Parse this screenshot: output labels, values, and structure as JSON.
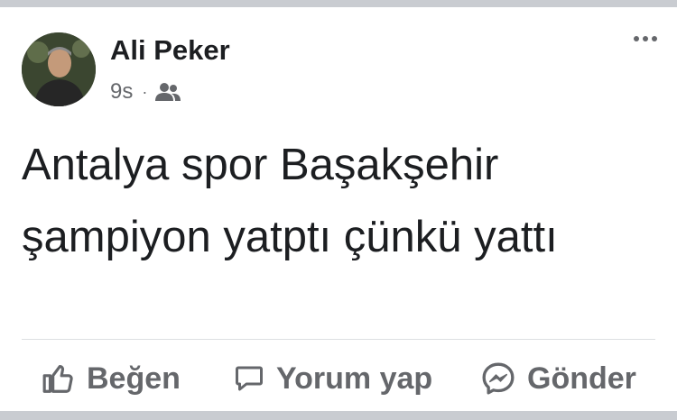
{
  "post": {
    "author": "Ali Peker",
    "time": "9s",
    "separator": "·",
    "audience_icon": "friends-icon",
    "text": "Antalya spor Başakşehir şampiyon yatptı çünkü yattı"
  },
  "actions": {
    "like_label": "Beğen",
    "comment_label": "Yorum yap",
    "send_label": "Gönder"
  },
  "colors": {
    "text": "#1c1e21",
    "secondary": "#65676b",
    "background": "#c9ccd1"
  }
}
